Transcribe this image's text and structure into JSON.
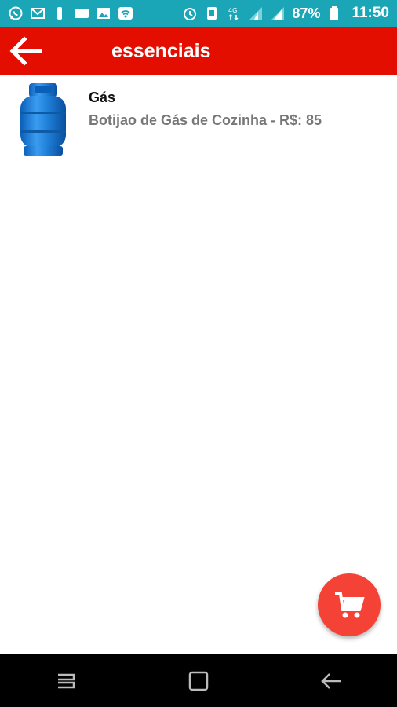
{
  "status_bar": {
    "battery_percent": "87%",
    "time": "11:50",
    "network": "4G",
    "icons_left": [
      "whatsapp-icon",
      "gmail-icon",
      "notification-icon",
      "weather-icon",
      "gallery-icon",
      "wifi-icon"
    ],
    "icons_right": [
      "alarm-icon",
      "nfc-icon",
      "data-icon",
      "signal-icon",
      "signal-icon",
      "battery-icon"
    ]
  },
  "appbar": {
    "title": "essenciais",
    "back_icon": "arrow-left-icon",
    "color": "#e30d00"
  },
  "items": [
    {
      "title": "Gás",
      "subtitle": "Botijao de Gás de Cozinha - R$: 85",
      "image": "gas-cylinder"
    }
  ],
  "fab": {
    "icon": "cart-icon",
    "color": "#f44336"
  },
  "nav_bar": {
    "buttons": [
      "recents-icon",
      "home-icon",
      "back-icon"
    ]
  }
}
